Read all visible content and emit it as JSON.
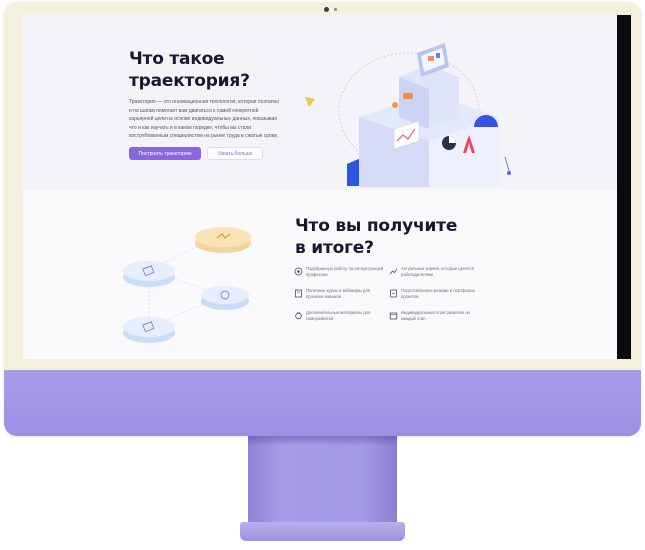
{
  "hero": {
    "title_line1": "Что такое",
    "title_line2": "траектория?",
    "description": "Траектория — это инновационная технология, которая поэтапно и по шагам помогает вам двигаться к самой конкретной карьерной цели на основе индивидуальных данных, показывая что и как изучать и в каком порядке, чтобы вы стали востребованным специалистом на рынке труда в сжатые сроки.",
    "primary_button": "Построить траекторию",
    "secondary_button": "Узнать больше"
  },
  "results": {
    "title_line1": "Что вы получите",
    "title_line2": "в итоге?",
    "items": [
      {
        "icon": "target-icon",
        "text": "Подобранную работу по интересующей профессии"
      },
      {
        "icon": "chart-icon",
        "text": "Актуальные знания, которые ценятся работодателями"
      },
      {
        "icon": "book-icon",
        "text": "Полезные курсы и вебинары для прокачки навыков"
      },
      {
        "icon": "document-icon",
        "text": "Подготовленное резюме и портфолио проектов"
      },
      {
        "icon": "medal-icon",
        "text": "Дополнительные материалы для саморазвития"
      },
      {
        "icon": "calendar-icon",
        "text": "Индивидуальный план развития на каждый этап"
      }
    ]
  },
  "colors": {
    "accent": "#8a66dc",
    "monitor_frame": "#f3f0de",
    "monitor_body": "#a79de8",
    "title_text": "#1a1830"
  }
}
